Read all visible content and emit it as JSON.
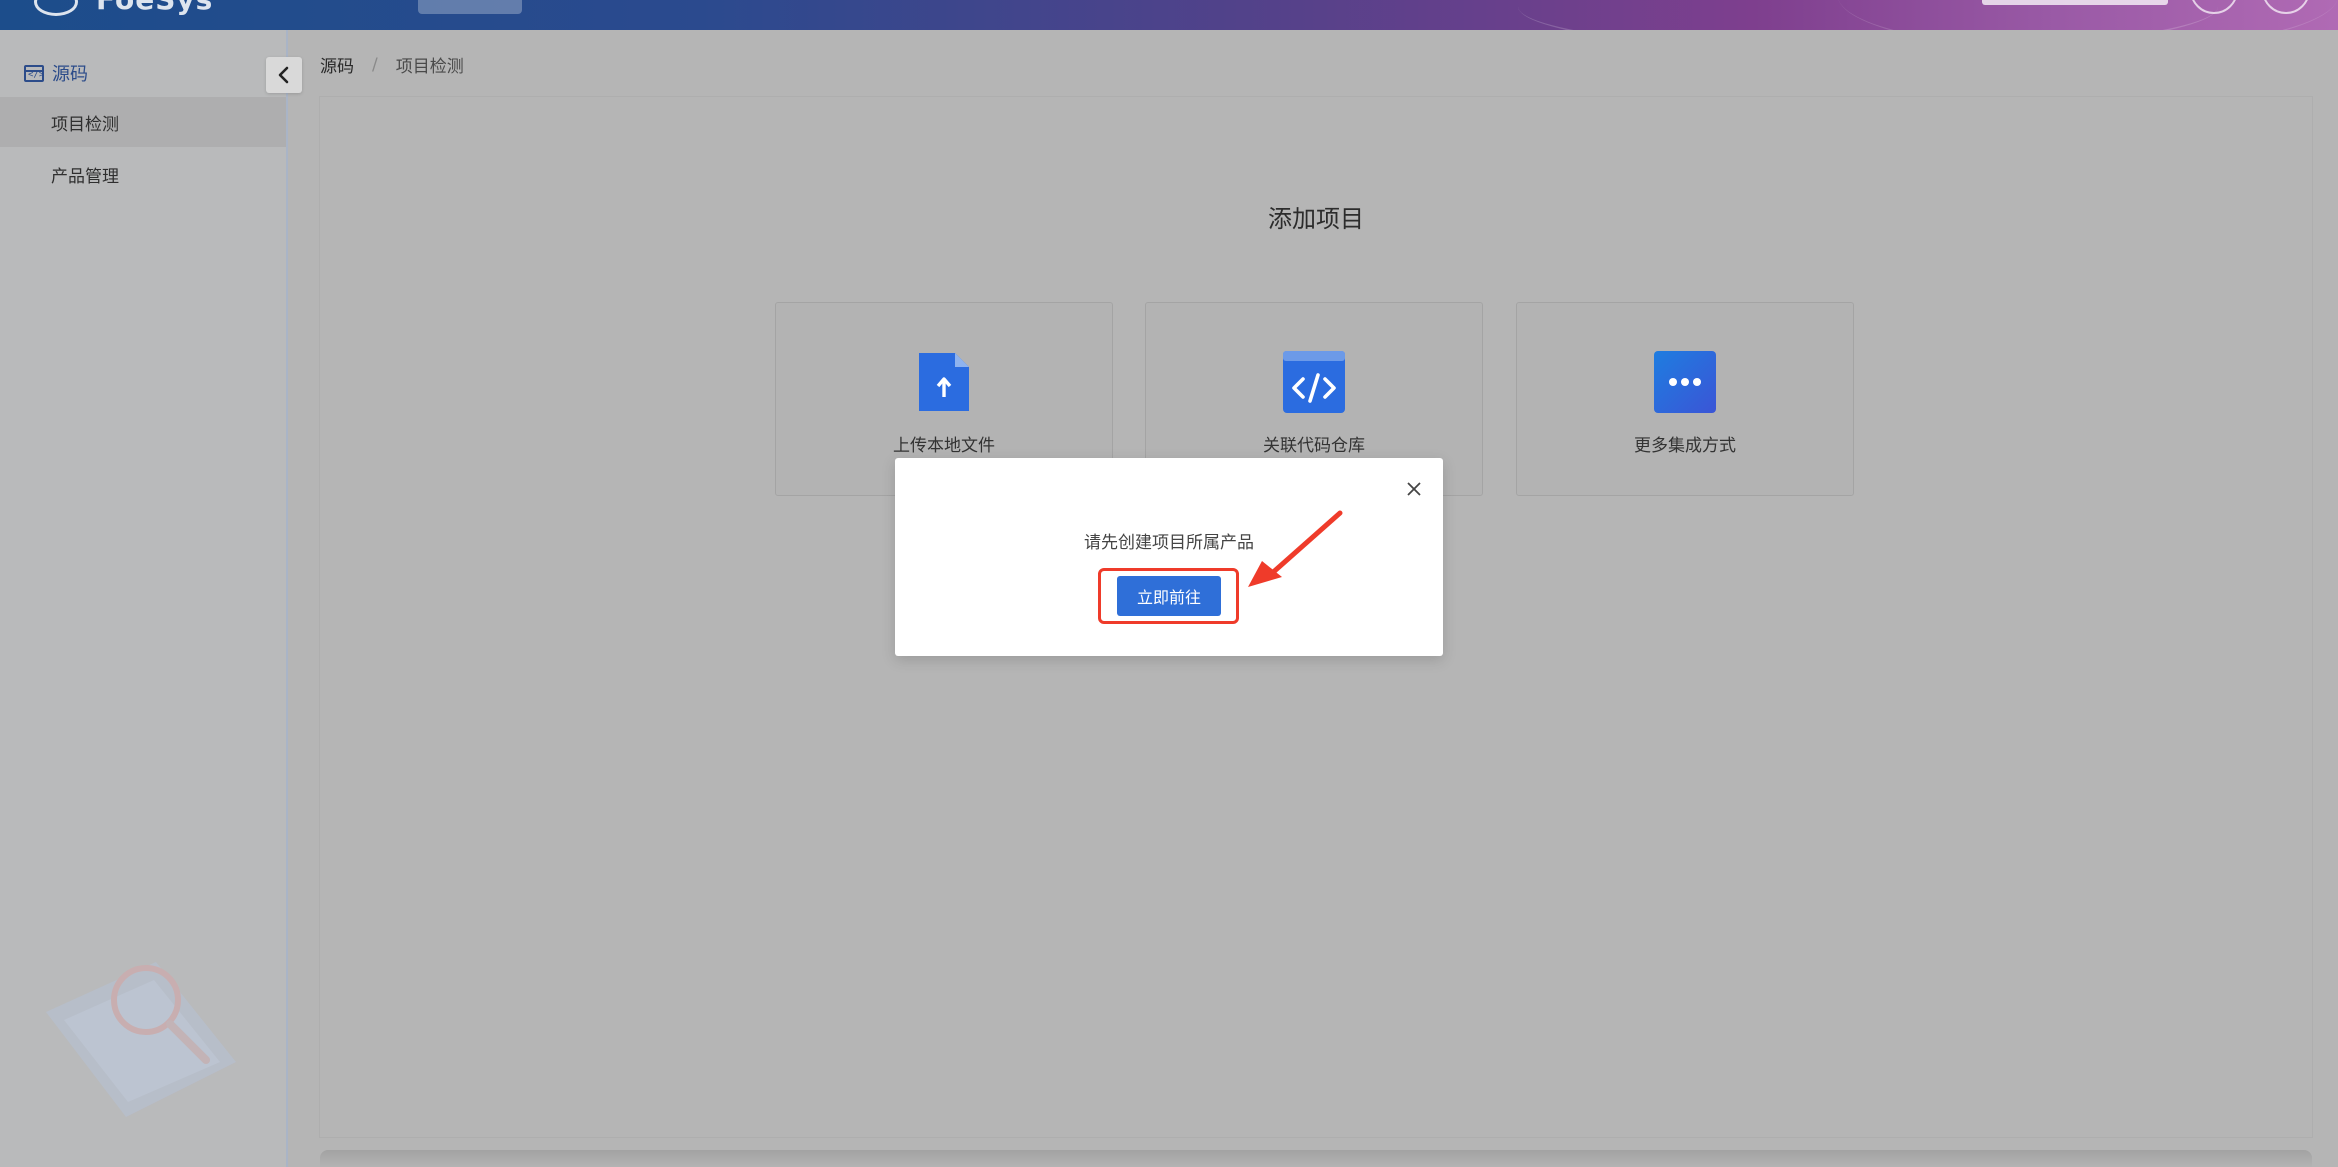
{
  "header": {
    "logo_text": "FoeSys"
  },
  "sidebar": {
    "section_title": "源码",
    "items": [
      {
        "label": "项目检测",
        "active": true
      },
      {
        "label": "产品管理",
        "active": false
      }
    ],
    "collapse_icon": "chevron-left-icon"
  },
  "breadcrumb": {
    "root": "源码",
    "separator": "/",
    "current": "项目检测"
  },
  "main": {
    "title": "添加项目",
    "options": [
      {
        "label": "上传本地文件",
        "icon": "upload-file-icon"
      },
      {
        "label": "关联代码仓库",
        "icon": "code-repo-icon"
      },
      {
        "label": "更多集成方式",
        "icon": "more-icon"
      }
    ]
  },
  "modal": {
    "message": "请先创建项目所属产品",
    "button_label": "立即前往",
    "close_icon": "close-icon"
  },
  "colors": {
    "primary": "#2f6fd8",
    "annotation": "#ef3b2a",
    "icon_blue": "#2b6ce0"
  }
}
